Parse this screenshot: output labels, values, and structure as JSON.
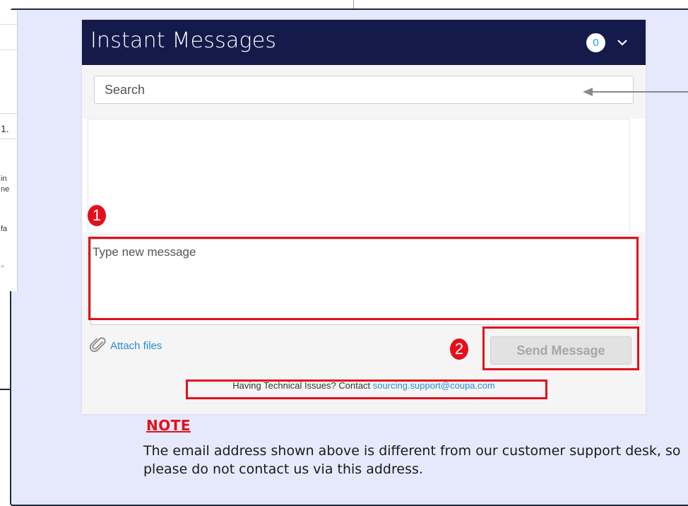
{
  "background_fragments": [
    "1.",
    "in",
    "ne",
    "fa",
    "»"
  ],
  "im": {
    "title": "Instant Messages",
    "unread_count": "0",
    "search": {
      "placeholder": "Search"
    },
    "compose": {
      "placeholder": "Type new message"
    },
    "attach_label": "Attach files",
    "send_label": "Send Message",
    "footer": {
      "prefix": "Having Technical Issues? Contact",
      "email": "sourcing.support@coupa.com"
    }
  },
  "annotations": {
    "marker_1": "1",
    "marker_2": "2"
  },
  "note": {
    "title": "NOTE",
    "text": "The email address shown above is different from our customer support desk, so please do not contact us via this address."
  },
  "colors": {
    "header": "#141a4a",
    "highlight": "#e3101b",
    "callout_bg": "#e6e9fb",
    "link": "#2a8ad4"
  }
}
